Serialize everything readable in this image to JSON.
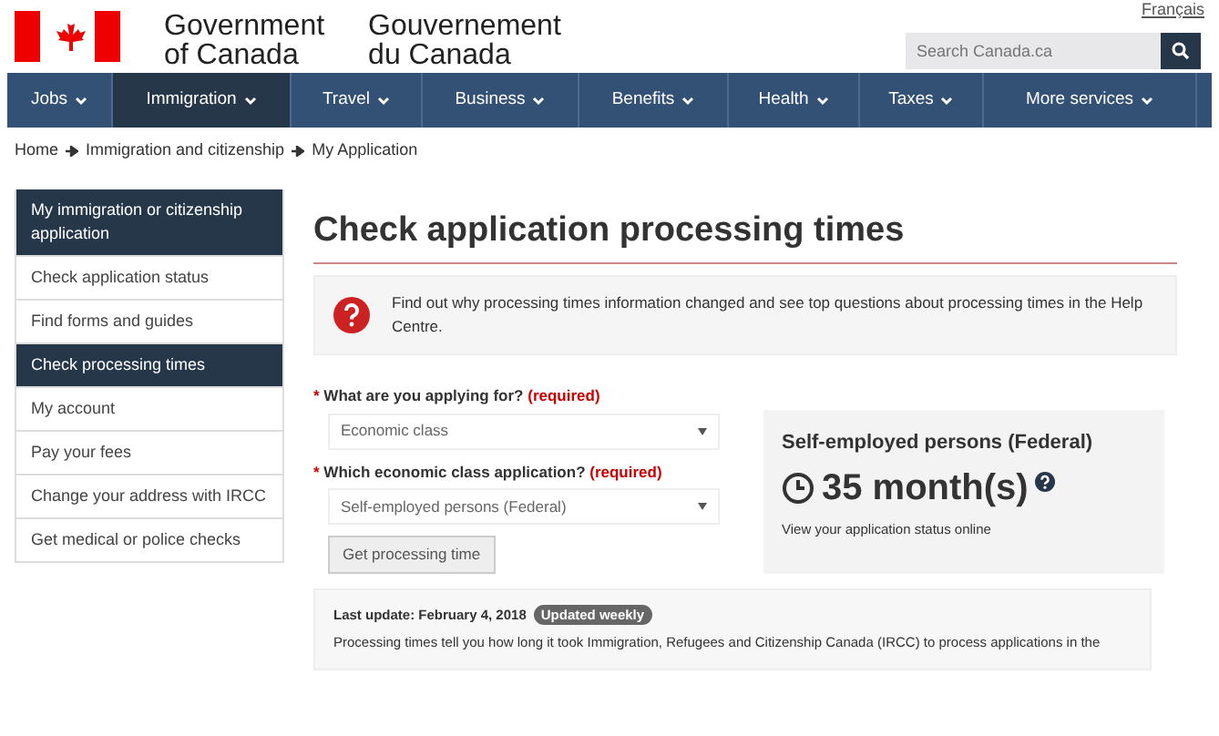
{
  "header": {
    "language_link": "Français",
    "wordmark_en": [
      "Government",
      "of Canada"
    ],
    "wordmark_fr": [
      "Gouvernement",
      "du Canada"
    ],
    "search": {
      "placeholder": "Search Canada.ca"
    }
  },
  "nav": [
    {
      "label": "Jobs",
      "selected": false
    },
    {
      "label": "Immigration",
      "selected": true
    },
    {
      "label": "Travel",
      "selected": false
    },
    {
      "label": "Business",
      "selected": false
    },
    {
      "label": "Benefits",
      "selected": false
    },
    {
      "label": "Health",
      "selected": false
    },
    {
      "label": "Taxes",
      "selected": false
    },
    {
      "label": "More services",
      "selected": false
    }
  ],
  "breadcrumb": [
    "Home",
    "Immigration and citizenship",
    "My Application"
  ],
  "sidebar": {
    "heading": "My immigration or citizenship application",
    "items": [
      {
        "label": "Check application status",
        "selected": false
      },
      {
        "label": "Find forms and guides",
        "selected": false
      },
      {
        "label": "Check processing times",
        "selected": true
      },
      {
        "label": "My account",
        "selected": false
      },
      {
        "label": "Pay your fees",
        "selected": false
      },
      {
        "label": "Change your address with IRCC",
        "selected": false
      },
      {
        "label": "Get medical or police checks",
        "selected": false
      }
    ]
  },
  "main": {
    "title": "Check application processing times",
    "notice": {
      "before": "Find out ",
      "link1": "why processing times information changed",
      "middle": " and see ",
      "link2": "top questions about processing times",
      "after": " in the Help Centre."
    },
    "fields": [
      {
        "marker": "*",
        "label": "What are you applying for?",
        "required": "(required)",
        "value": "Economic class"
      },
      {
        "marker": "*",
        "label": "Which economic class application?",
        "required": "(required)",
        "value": "Self-employed persons (Federal)"
      }
    ],
    "button": "Get processing time",
    "result": {
      "title": "Self-employed persons (Federal)",
      "time": "35 month(s)",
      "note_before": "View your ",
      "note_link": "application status online"
    },
    "update": {
      "label": "Last update: February 4, 2018",
      "badge": "Updated weekly",
      "text": "Processing times tell you how long it took Immigration, Refugees and Citizenship Canada (IRCC) to process applications in the"
    }
  }
}
